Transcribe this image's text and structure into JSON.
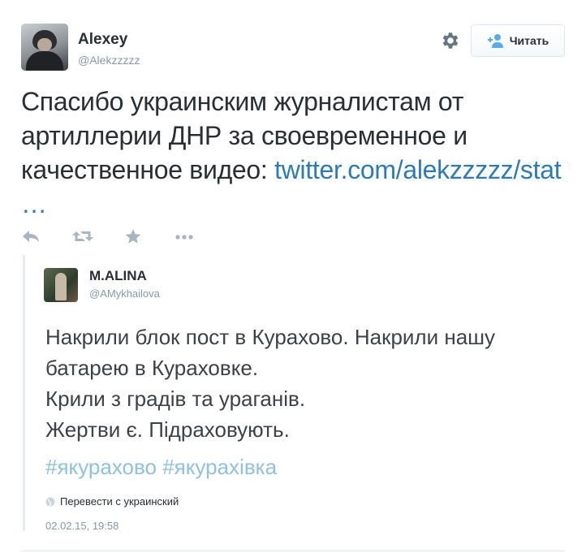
{
  "tweet": {
    "author_name": "Alexey",
    "author_handle": "@Alekzzzzz",
    "follow_label": "Читать",
    "text_main": "Спасибо украинским журналистам от артиллерии ДНР за своевременное и качественное видео: ",
    "link_text": "twitter.com/alekzzzzz/stat …",
    "actions": [
      "reply-icon",
      "retweet-icon",
      "favorite-icon",
      "more-icon"
    ]
  },
  "quoted": {
    "author_name": "M.ALINA",
    "author_handle": "@AMykhailova",
    "lines": [
      "Накрили блок пост в Курахово. Накрили нашу батарею в Кураховке.",
      "Крили з градів та ураганів.",
      "Жертви є. Підраховують."
    ],
    "hashtags": [
      "#якурахово",
      "#якурахівка"
    ],
    "translate_label": "Перевести с украинский",
    "timestamp": "02.02.15, 19:58"
  },
  "colors": {
    "link": "#2b7bb9",
    "hashtag": "#8fc1e0",
    "muted": "#8899a6",
    "icon": "#a9b5bf",
    "text": "#292f33"
  }
}
